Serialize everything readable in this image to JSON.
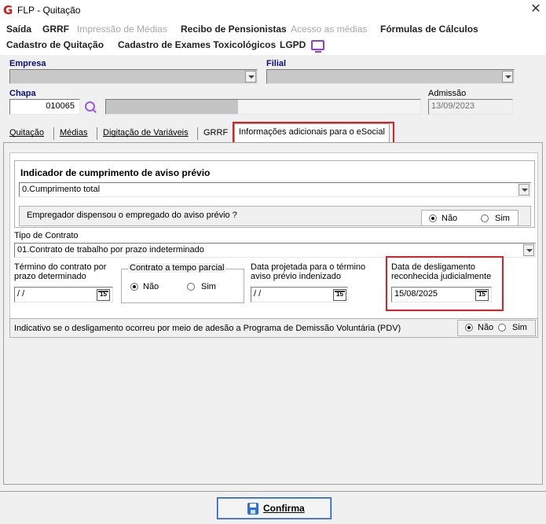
{
  "window": {
    "title": "FLP - Quitação",
    "logo": "G"
  },
  "menu": {
    "row1": [
      {
        "label": "Saída",
        "disabled": false
      },
      {
        "label": "GRRF",
        "disabled": false
      },
      {
        "label": "Impressão de Médias",
        "disabled": true
      },
      {
        "label": "Recibo de Pensionistas",
        "disabled": false
      },
      {
        "label": "Acesso as médias",
        "disabled": true
      },
      {
        "label": "Fórmulas de Cálculos",
        "disabled": false
      }
    ],
    "row2": [
      {
        "label": "Cadastro de Quitação"
      },
      {
        "label": "Cadastro de Exames Toxicológicos"
      },
      {
        "label": "LGPD"
      }
    ]
  },
  "header": {
    "empresa_label": "Empresa",
    "filial_label": "Filial",
    "chapa_label": "Chapa",
    "chapa_value": "010065",
    "admissao_label": "Admissão",
    "admissao_value": "13/09/2023"
  },
  "tabs": [
    {
      "label": "Quitação",
      "active": false
    },
    {
      "label": "Médias",
      "active": false
    },
    {
      "label": "Digitação de Variáveis",
      "active": false
    },
    {
      "label": "GRRF",
      "active": false
    },
    {
      "label": "Informações adicionais para o eSocial",
      "active": true
    }
  ],
  "esocial": {
    "aviso_title": "Indicador de cumprimento de aviso prévio",
    "aviso_value": "0.Cumprimento total",
    "dispensou_question": "Empregador dispensou o empregado do aviso prévio ?",
    "dispensou_options": [
      "Não",
      "Sim"
    ],
    "dispensou_selected": "Não",
    "tipo_contrato_label": "Tipo de Contrato",
    "tipo_contrato_value": "01.Contrato de trabalho por prazo indeterminado",
    "termino_label_1": "Término do contrato por",
    "termino_label_2": "prazo determinado",
    "termino_value": " /  /",
    "tempo_parcial_title": "Contrato a tempo parcial",
    "tempo_parcial_options": [
      "Não",
      "Sim"
    ],
    "tempo_parcial_selected": "Não",
    "projetada_label_1": "Data projetada para o término",
    "projetada_label_2": "aviso prévio indenizado",
    "projetada_value": " /  /",
    "desligamento_label_1": "Data de desligamento",
    "desligamento_label_2": "reconhecida judicialmente",
    "desligamento_value": "15/08/2025",
    "calendar_icon_text": "15",
    "pdv_question": "Indicativo se o desligamento ocorreu por meio de adesão a Programa de Demissão Voluntária (PDV)",
    "pdv_options": [
      "Não",
      "Sim"
    ],
    "pdv_selected": "Não"
  },
  "footer": {
    "confirm_label": "Confirma"
  },
  "colors": {
    "highlight_red": "#e02020",
    "accent_purple": "#8e3fd8",
    "label_blue": "#0c0c7a",
    "button_blue": "#1c55c8"
  },
  "icons": [
    "app-logo-icon",
    "close-icon",
    "monitor-icon",
    "search-icon",
    "chevron-down-icon",
    "calendar-icon",
    "save-icon"
  ]
}
